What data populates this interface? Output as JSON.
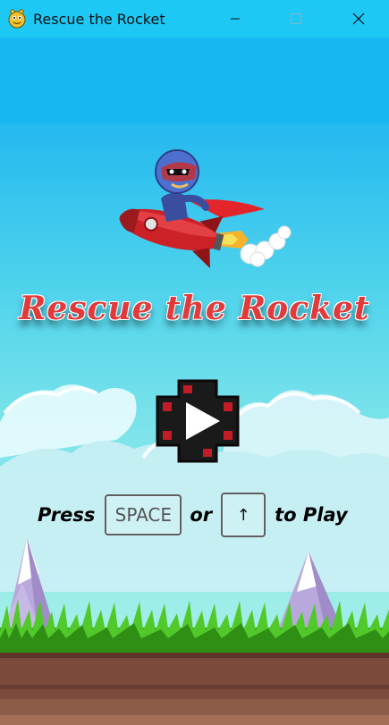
{
  "window": {
    "title": "Rescue the Rocket",
    "controls": [
      "minimize",
      "maximize",
      "close"
    ]
  },
  "game": {
    "title": "Rescue the Rocket",
    "hero": "rocket-rider-icon",
    "play_button_icon": "play-icon",
    "instructions": {
      "press": "Press",
      "key1": "SPACE",
      "or": "or",
      "key2": "↑",
      "to_play": "to Play"
    }
  },
  "colors": {
    "titlebar": "#1ec8f5",
    "sky_top": "#16b8f4",
    "title_text": "#e23a3a",
    "grass": "#3cae1a",
    "dirt": "#7b4a3a"
  }
}
